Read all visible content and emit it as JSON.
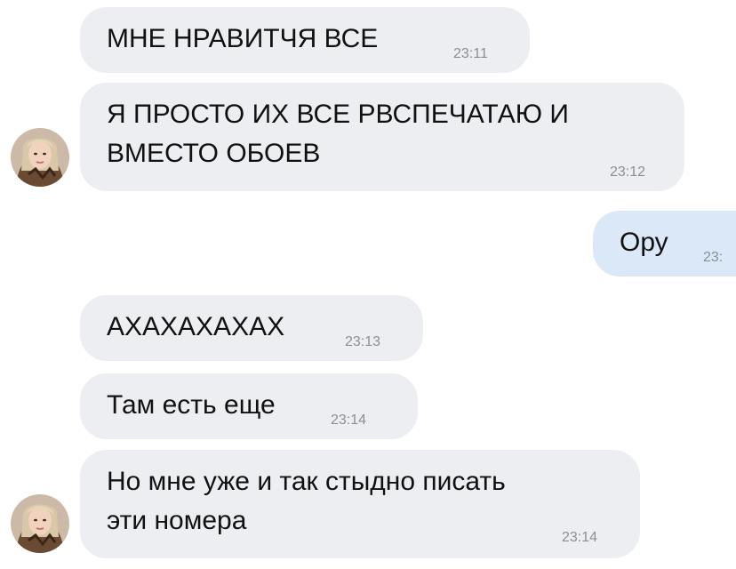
{
  "messages": [
    {
      "text": "МНЕ НРАВИТЧЯ ВСЕ",
      "time": "23:11",
      "direction": "incoming"
    },
    {
      "text": "Я ПРОСТО ИХ ВСЕ РВСПЕЧАТАЮ И\nВМЕСТО ОБОЕВ",
      "time": "23:12",
      "direction": "incoming"
    },
    {
      "text": "Ору",
      "time": "23:",
      "direction": "outgoing"
    },
    {
      "text": "АХАХАХАХАХ",
      "time": "23:13",
      "direction": "incoming"
    },
    {
      "text": "Там есть еще",
      "time": "23:14",
      "direction": "incoming"
    },
    {
      "text": "Но мне уже и так стыдно писать\nэти номера",
      "time": "23:14",
      "direction": "incoming"
    }
  ],
  "avatar_icon": "contact-avatar-photo",
  "colors": {
    "incoming_bubble": "#edeef2",
    "outgoing_bubble": "#dbe8f7",
    "timestamp": "#8a8f96",
    "text": "#111111"
  }
}
